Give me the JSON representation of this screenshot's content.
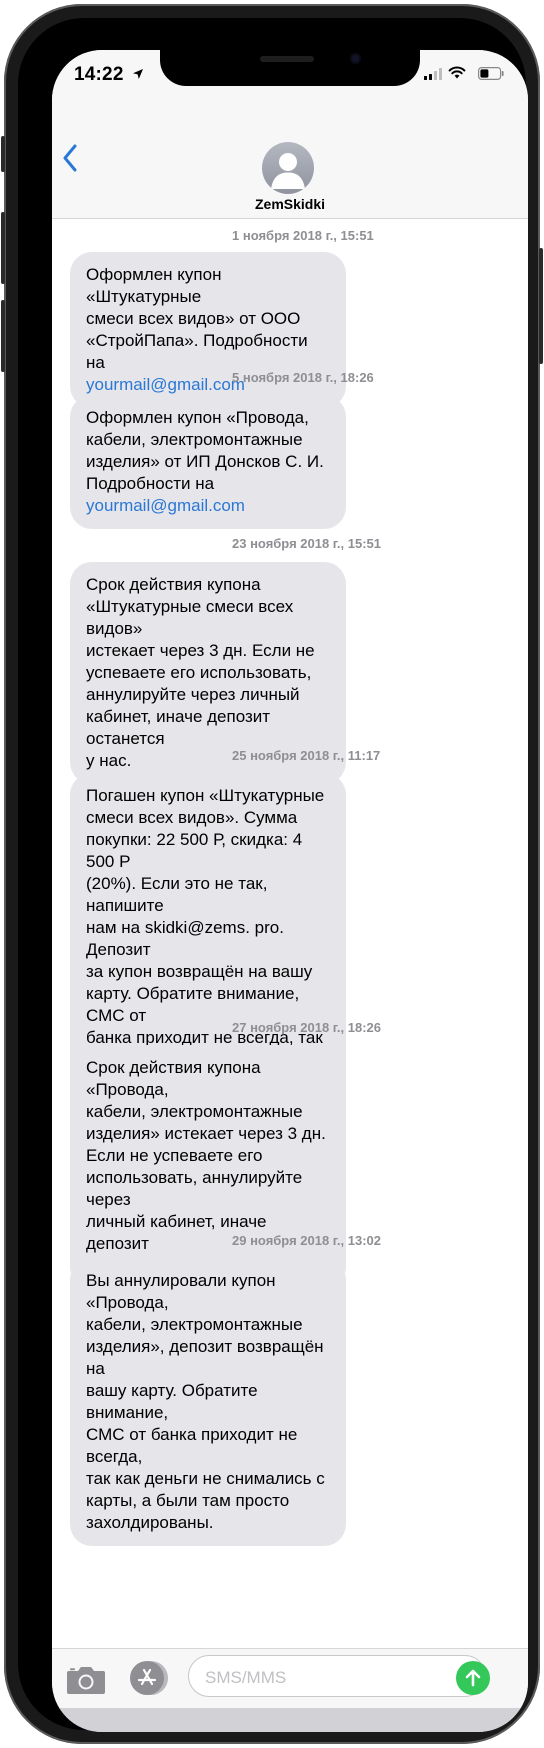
{
  "status_bar": {
    "time": "14:22"
  },
  "header": {
    "contact_name": "ZemSkidki"
  },
  "messages": [
    {
      "timestamp": "1 ноября 2018 г., 15:51",
      "text": "Оформлен купон «Штукатурные\nсмеси всех видов» от ООО\n«СтройПапа». Подробности на",
      "link": "yourmail@gmail.com"
    },
    {
      "timestamp": "5 ноября 2018 г., 18:26",
      "text": "Оформлен купон «Провода,\nкабели, электромонтажные\nизделия» от ИП Донсков С. И.\nПодробности на",
      "link": "yourmail@gmail.com"
    },
    {
      "timestamp": "23 ноября 2018 г., 15:51",
      "text": "Срок действия купона\n«Штукатурные смеси всех видов»\nистекает через 3 дн. Если не\nуспеваете его использовать,\nаннулируйте через личный\nкабинет, иначе депозит останется\nу нас."
    },
    {
      "timestamp": "25 ноября 2018 г., 11:17",
      "text": "Погашен купон «Штукатурные\nсмеси всех видов». Сумма\nпокупки: 22 500 Р, скидка: 4 500 Р\n(20%). Если это не так, напишите\nнам на skidki@zems. pro. Депозит\nза купон возвращён на вашу\nкарту. Обратите внимание, СМС от\nбанка приходит не всегда, так как\nденьги не снимались с карты, а\nбыли там просто захолдированы."
    },
    {
      "timestamp": "27 ноября 2018 г., 18:26",
      "text": "Срок действия купона «Провода,\nкабели, электромонтажные\nизделия» истекает через 3 дн.\nЕсли не успеваете его\nиспользовать, аннулируйте через\nличный кабинет, иначе депозит\nостанется у нас."
    },
    {
      "timestamp": "29 ноября 2018 г., 13:02",
      "text": "Вы аннулировали купон «Провода,\nкабели, электромонтажные\nизделия», депозит возвращён на\nвашу карту. Обратите внимание,\nСМС от банка приходит не всегда,\nтак как деньги не снимались с\nкарты, а были там просто\nзахолдированы."
    }
  ],
  "input_bar": {
    "placeholder": "SMS/MMS"
  },
  "icons": {
    "back": "chevron-left-icon",
    "camera": "camera-icon",
    "apps": "app-store-icon",
    "send": "arrow-up-icon",
    "location": "location-arrow-icon",
    "signal": "cellular-signal-icon",
    "wifi": "wifi-icon",
    "battery": "battery-icon"
  },
  "colors": {
    "accent": "#2a78d6",
    "bubble": "#e5e5ea",
    "send": "#34c759",
    "timestamp": "#8e8e93"
  }
}
